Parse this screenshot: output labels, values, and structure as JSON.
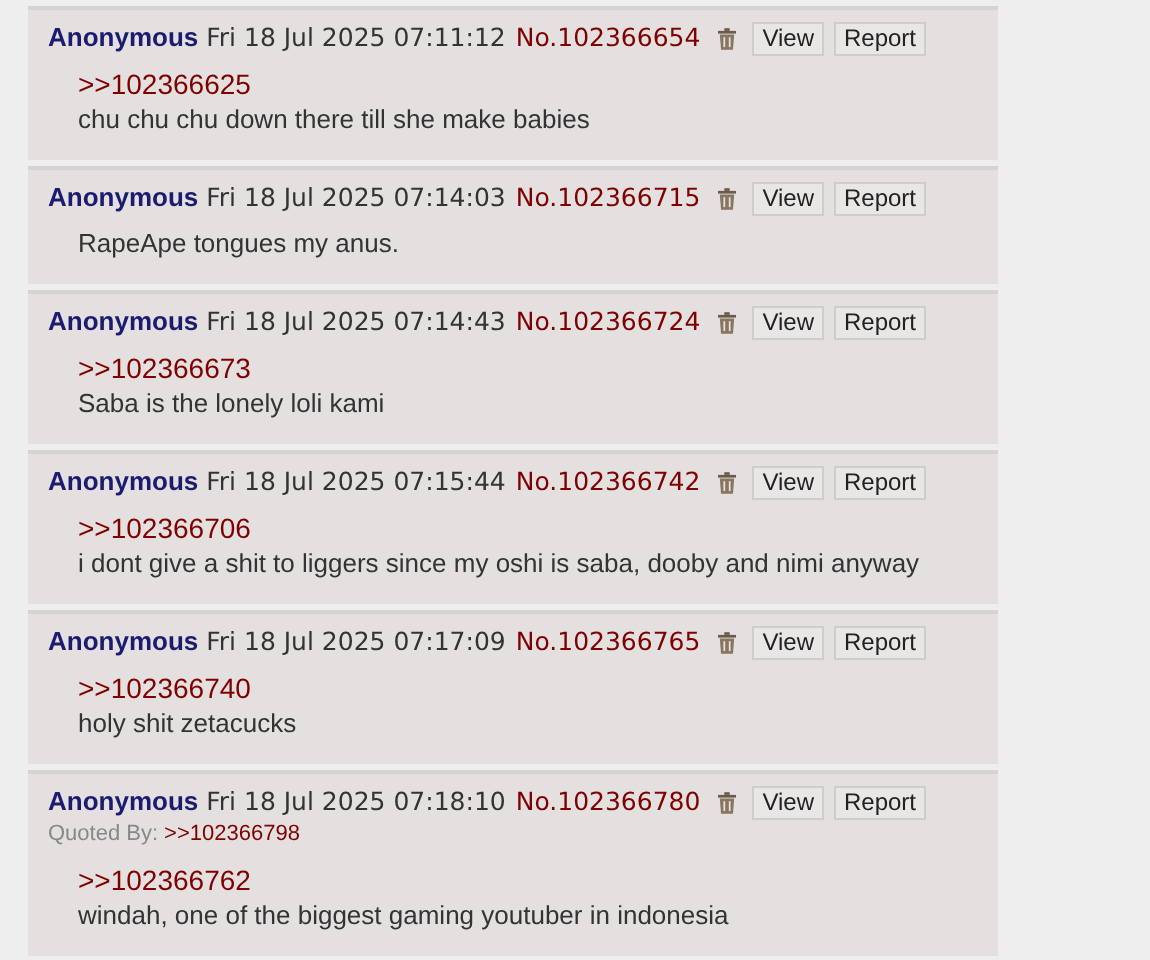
{
  "posts": [
    {
      "name": "Anonymous",
      "date": "Fri 18 Jul 2025 07:11:12",
      "number": "No.102366654",
      "view": "View",
      "report": "Report",
      "quote": ">>102366625",
      "text": "chu chu chu down there till she make babies"
    },
    {
      "name": "Anonymous",
      "date": "Fri 18 Jul 2025 07:14:03",
      "number": "No.102366715",
      "view": "View",
      "report": "Report",
      "text": "RapeApe tongues my anus."
    },
    {
      "name": "Anonymous",
      "date": "Fri 18 Jul 2025 07:14:43",
      "number": "No.102366724",
      "view": "View",
      "report": "Report",
      "quote": ">>102366673",
      "text": "Saba is the lonely loli kami"
    },
    {
      "name": "Anonymous",
      "date": "Fri 18 Jul 2025 07:15:44",
      "number": "No.102366742",
      "view": "View",
      "report": "Report",
      "quote": ">>102366706",
      "text": "i dont give a shit to liggers since my oshi is saba, dooby and nimi anyway"
    },
    {
      "name": "Anonymous",
      "date": "Fri 18 Jul 2025 07:17:09",
      "number": "No.102366765",
      "view": "View",
      "report": "Report",
      "quote": ">>102366740",
      "text": "holy shit zetacucks"
    },
    {
      "name": "Anonymous",
      "date": "Fri 18 Jul 2025 07:18:10",
      "number": "No.102366780",
      "view": "View",
      "report": "Report",
      "quoted_by_label": "Quoted By:",
      "quoted_by": ">>102366798",
      "quote": ">>102366762",
      "text": "windah, one of the biggest gaming youtuber in indonesia"
    }
  ]
}
